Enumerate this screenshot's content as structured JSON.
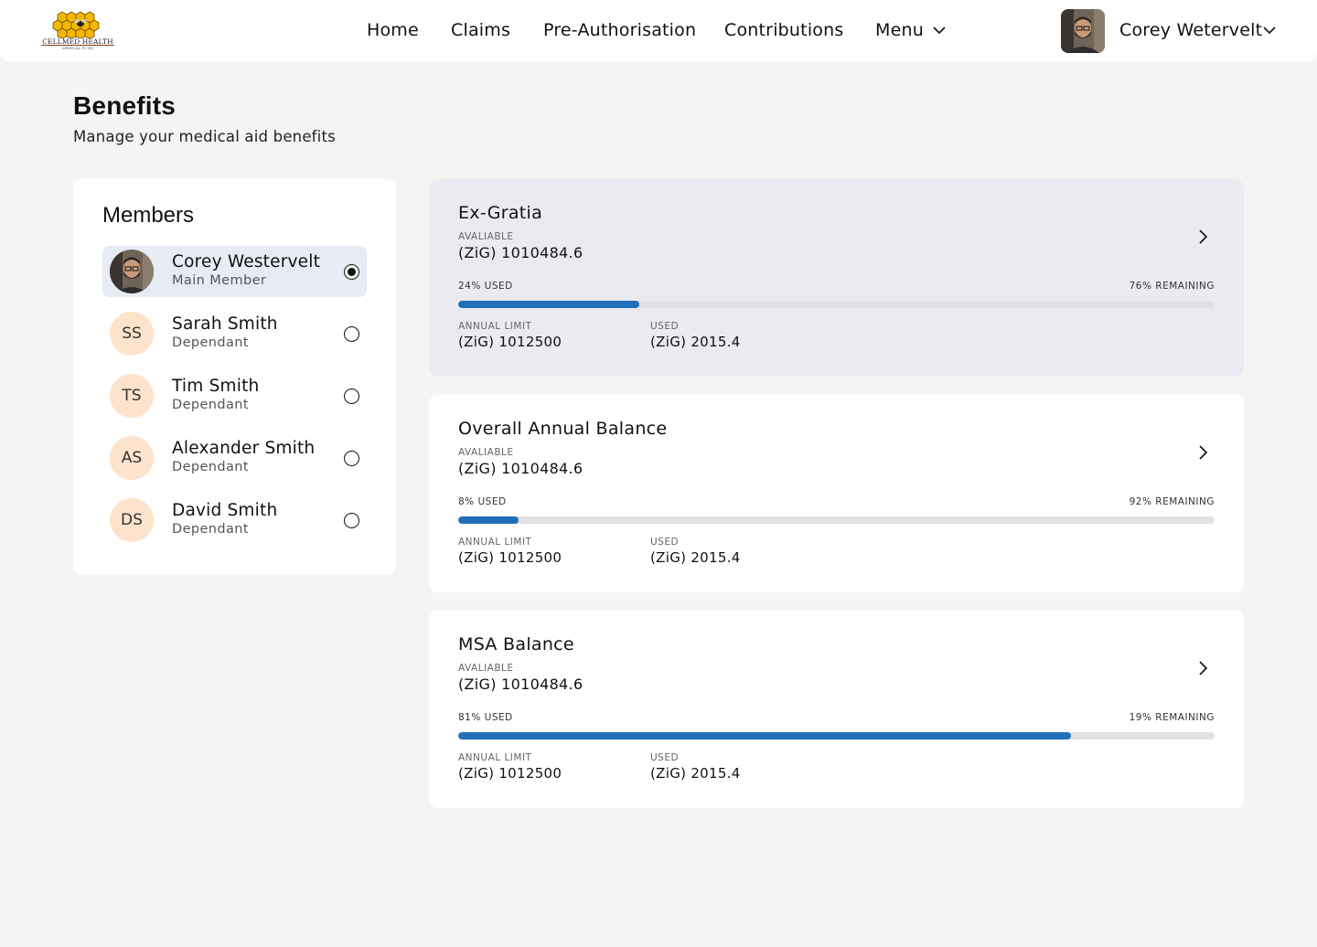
{
  "brand": {
    "name": "CELLMED HEALTH",
    "tagline": "MEDICAL FUND"
  },
  "nav": {
    "home": "Home",
    "claims": "Claims",
    "preauth": "Pre-Authorisation",
    "contributions": "Contributions",
    "menu": "Menu"
  },
  "user": {
    "name": "Corey Wetervelt"
  },
  "page": {
    "title": "Benefits",
    "subtitle": "Manage your medical aid benefits"
  },
  "members": {
    "title": "Members",
    "list": [
      {
        "name": "Corey Westervelt",
        "role": "Main Member",
        "initials": "",
        "selected": true
      },
      {
        "name": "Sarah Smith",
        "role": "Dependant",
        "initials": "SS",
        "selected": false
      },
      {
        "name": "Tim Smith",
        "role": "Dependant",
        "initials": "TS",
        "selected": false
      },
      {
        "name": "Alexander Smith",
        "role": "Dependant",
        "initials": "AS",
        "selected": false
      },
      {
        "name": "David Smith",
        "role": "Dependant",
        "initials": "DS",
        "selected": false
      }
    ]
  },
  "benefits": [
    {
      "title": "Ex-Gratia",
      "available_label": "AVALIABLE",
      "available": "(ZiG) 1010484.6",
      "used_pct_label": "24% USED",
      "remaining_label": "76% REMAINING",
      "used_fraction": 0.24,
      "limit_label": "ANNUAL LIMIT",
      "limit": "(ZiG) 1012500",
      "used_label": "USED",
      "used": "(ZiG) 2015.4"
    },
    {
      "title": "Overall Annual Balance",
      "available_label": "AVALIABLE",
      "available": "(ZiG) 1010484.6",
      "used_pct_label": "8% USED",
      "remaining_label": "92% REMAINING",
      "used_fraction": 0.08,
      "limit_label": "ANNUAL LIMIT",
      "limit": "(ZiG) 1012500",
      "used_label": "USED",
      "used": "(ZiG) 2015.4"
    },
    {
      "title": "MSA Balance",
      "available_label": "AVALIABLE",
      "available": "(ZiG) 1010484.6",
      "used_pct_label": "81% USED",
      "remaining_label": "19% REMAINING",
      "used_fraction": 0.81,
      "limit_label": "ANNUAL LIMIT",
      "limit": "(ZiG) 1012500",
      "used_label": "USED",
      "used": "(ZiG) 2015.4"
    }
  ],
  "colors": {
    "accent": "#1f70b8",
    "avatar_bg": "#fde3cb",
    "selected_bg": "#e6ebf4",
    "logo_gold": "#f5b800"
  },
  "icons": {
    "logo": "honeycomb-bee-logo",
    "chevron_down": "chevron-down-icon",
    "chevron_right": "chevron-right-icon"
  }
}
